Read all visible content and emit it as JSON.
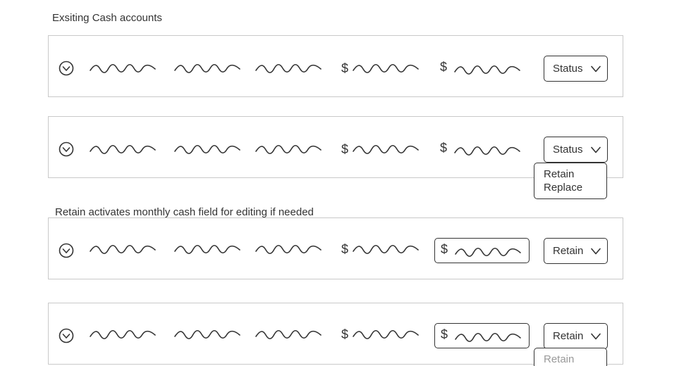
{
  "sections": {
    "existing_title": "Exsiting Cash accounts",
    "retain_note": "Retain activates monthly cash field for editing if needed"
  },
  "currency_symbol": "$",
  "rows": [
    {
      "status_label": "Status",
      "cash_editable": false
    },
    {
      "status_label": "Status",
      "cash_editable": false,
      "dropdown_open": true
    },
    {
      "status_label": "Retain",
      "cash_editable": true
    },
    {
      "status_label": "Retain",
      "cash_editable": true,
      "dropdown_open": true
    }
  ],
  "dropdown_options": [
    "Retain",
    "Replace"
  ],
  "colors": {
    "border": "#c9c9c9",
    "stroke": "#333333",
    "muted_text": "#999999"
  }
}
